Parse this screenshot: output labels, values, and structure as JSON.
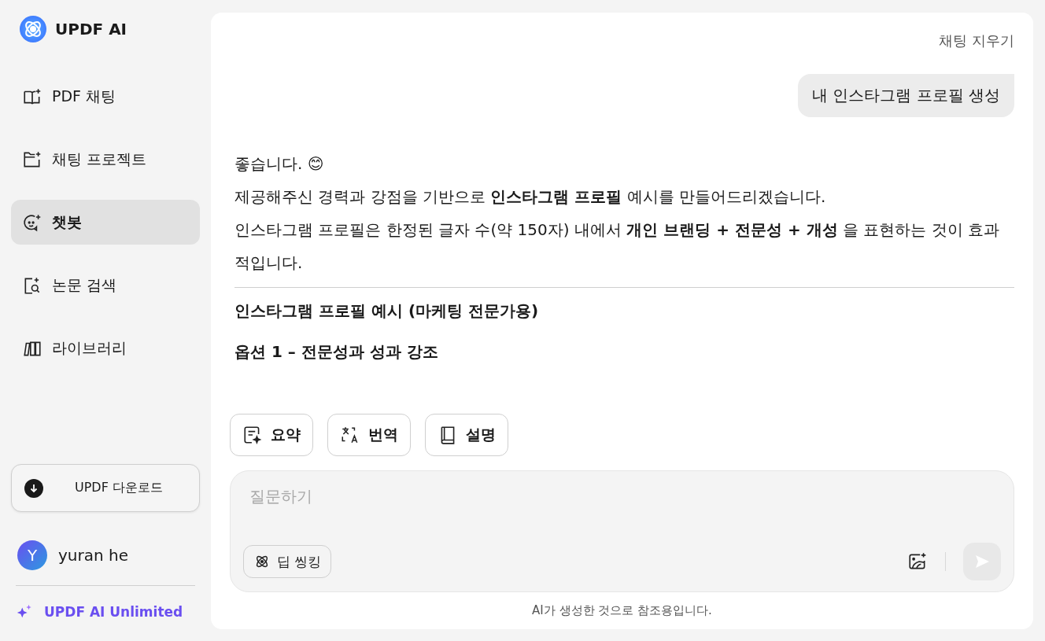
{
  "app": {
    "name": "UPDF AI"
  },
  "sidebar": {
    "items": [
      {
        "label": "PDF 채팅",
        "selected": false
      },
      {
        "label": "채팅 프로젝트",
        "selected": false
      },
      {
        "label": "챗봇",
        "selected": true
      },
      {
        "label": "논문 검색",
        "selected": false
      },
      {
        "label": "라이브러리",
        "selected": false
      }
    ],
    "download_button": "UPDF 다운로드",
    "user": {
      "initial": "Y",
      "name": "yuran he"
    },
    "plan": "UPDF AI Unlimited"
  },
  "chat": {
    "clear_button": "채팅 지우기",
    "user_message": "내 인스타그램 프로필 생성",
    "reply": {
      "paragraphs": [
        "좋습니다. 😊",
        "제공해주신 경력과 강점을 기반으로 **인스타그램 프로필** 예시를 만들어드리겠습니다.",
        "인스타그램 프로필은 한정된 글자 수(약 150자) 내에서 **개인 브랜딩 + 전문성 + 개성** 을 표현하는 것이 효과적입니다."
      ],
      "headings": [
        "인스타그램 프로필 예시 (마케팅 전문가용)",
        "옵션 1 – 전문성과 성과 강조"
      ]
    },
    "actions": [
      "요약",
      "번역",
      "설명"
    ],
    "input": {
      "placeholder": "질문하기",
      "deep_thinking": "딥 씽킹"
    },
    "disclaimer": "AI가 생성한 것으로 참조용입니다."
  }
}
